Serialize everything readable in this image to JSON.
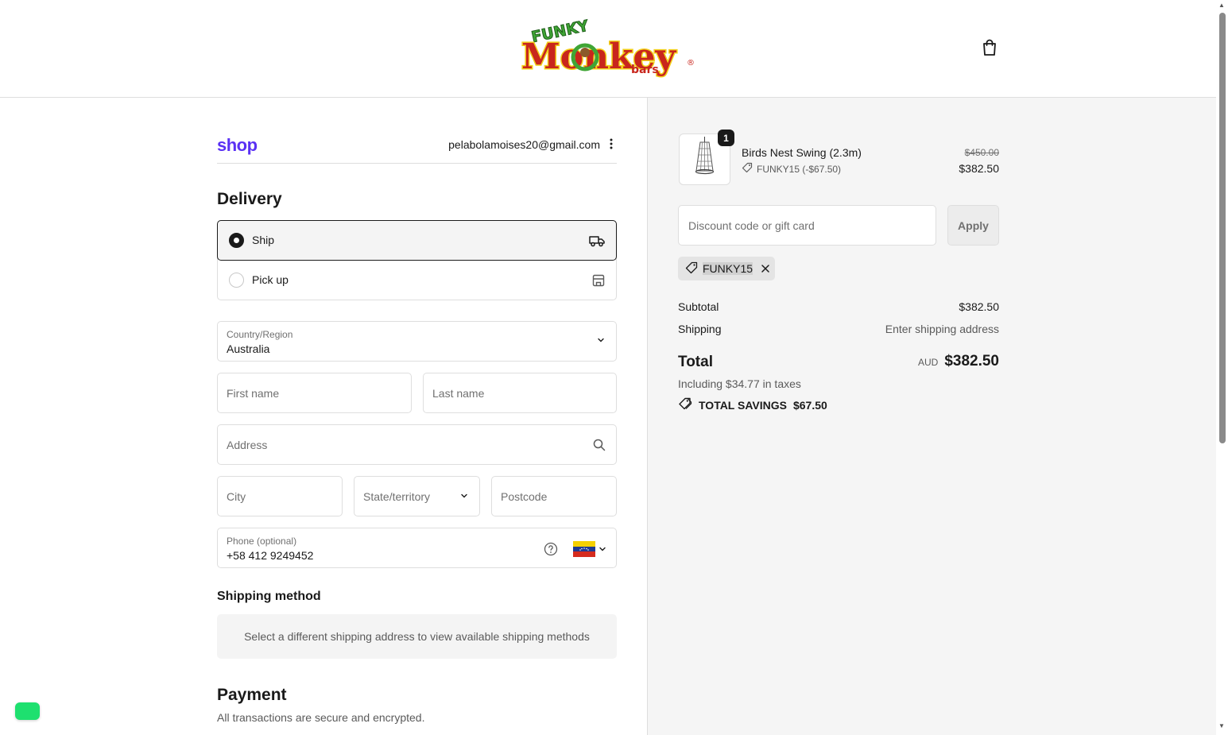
{
  "header": {
    "logo_top": "FUNKY",
    "logo_main": "Monkey",
    "logo_sub": "bars",
    "logo_mark": "®"
  },
  "account": {
    "brand": "shop",
    "email": "pelabolamoises20@gmail.com"
  },
  "delivery": {
    "title": "Delivery",
    "options": [
      {
        "label": "Ship",
        "selected": true,
        "icon": "truck-icon"
      },
      {
        "label": "Pick up",
        "selected": false,
        "icon": "store-icon"
      }
    ]
  },
  "form": {
    "country": {
      "label": "Country/Region",
      "value": "Australia"
    },
    "first_name": {
      "placeholder": "First name"
    },
    "last_name": {
      "placeholder": "Last name"
    },
    "address": {
      "placeholder": "Address"
    },
    "city": {
      "placeholder": "City"
    },
    "state": {
      "placeholder": "State/territory"
    },
    "postcode": {
      "placeholder": "Postcode"
    },
    "phone": {
      "label": "Phone (optional)",
      "value": "+58 412 9249452"
    }
  },
  "shipping_method": {
    "title": "Shipping method",
    "message": "Select a different shipping address to view available shipping methods"
  },
  "payment": {
    "title": "Payment",
    "subtitle": "All transactions are secure and encrypted."
  },
  "cart": {
    "item": {
      "quantity": "1",
      "name": "Birds Nest Swing (2.3m)",
      "discount": "FUNKY15 (-$67.50)",
      "original_price": "$450.00",
      "price": "$382.50"
    },
    "discount_input": {
      "placeholder": "Discount code or gift card"
    },
    "apply_label": "Apply",
    "applied_code": "FUNKY15",
    "subtotal_label": "Subtotal",
    "subtotal_value": "$382.50",
    "shipping_label": "Shipping",
    "shipping_value": "Enter shipping address",
    "total_label": "Total",
    "total_currency": "AUD",
    "total_value": "$382.50",
    "tax_note": "Including $34.77 in taxes",
    "savings_label": "TOTAL SAVINGS",
    "savings_value": "$67.50"
  },
  "colors": {
    "shop_brand": "#5a31f4",
    "chat_button": "#1ee06f",
    "logo_green": "#3fa535",
    "logo_red": "#c8261d",
    "logo_yellow": "#f3d21b"
  }
}
